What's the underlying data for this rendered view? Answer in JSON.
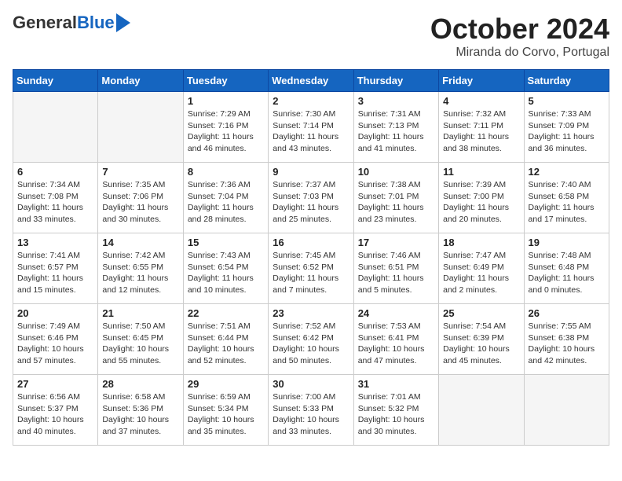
{
  "logo": {
    "general": "General",
    "blue": "Blue"
  },
  "title": "October 2024",
  "location": "Miranda do Corvo, Portugal",
  "days_of_week": [
    "Sunday",
    "Monday",
    "Tuesday",
    "Wednesday",
    "Thursday",
    "Friday",
    "Saturday"
  ],
  "weeks": [
    [
      {
        "day": "",
        "info": ""
      },
      {
        "day": "",
        "info": ""
      },
      {
        "day": "1",
        "info": "Sunrise: 7:29 AM\nSunset: 7:16 PM\nDaylight: 11 hours and 46 minutes."
      },
      {
        "day": "2",
        "info": "Sunrise: 7:30 AM\nSunset: 7:14 PM\nDaylight: 11 hours and 43 minutes."
      },
      {
        "day": "3",
        "info": "Sunrise: 7:31 AM\nSunset: 7:13 PM\nDaylight: 11 hours and 41 minutes."
      },
      {
        "day": "4",
        "info": "Sunrise: 7:32 AM\nSunset: 7:11 PM\nDaylight: 11 hours and 38 minutes."
      },
      {
        "day": "5",
        "info": "Sunrise: 7:33 AM\nSunset: 7:09 PM\nDaylight: 11 hours and 36 minutes."
      }
    ],
    [
      {
        "day": "6",
        "info": "Sunrise: 7:34 AM\nSunset: 7:08 PM\nDaylight: 11 hours and 33 minutes."
      },
      {
        "day": "7",
        "info": "Sunrise: 7:35 AM\nSunset: 7:06 PM\nDaylight: 11 hours and 30 minutes."
      },
      {
        "day": "8",
        "info": "Sunrise: 7:36 AM\nSunset: 7:04 PM\nDaylight: 11 hours and 28 minutes."
      },
      {
        "day": "9",
        "info": "Sunrise: 7:37 AM\nSunset: 7:03 PM\nDaylight: 11 hours and 25 minutes."
      },
      {
        "day": "10",
        "info": "Sunrise: 7:38 AM\nSunset: 7:01 PM\nDaylight: 11 hours and 23 minutes."
      },
      {
        "day": "11",
        "info": "Sunrise: 7:39 AM\nSunset: 7:00 PM\nDaylight: 11 hours and 20 minutes."
      },
      {
        "day": "12",
        "info": "Sunrise: 7:40 AM\nSunset: 6:58 PM\nDaylight: 11 hours and 17 minutes."
      }
    ],
    [
      {
        "day": "13",
        "info": "Sunrise: 7:41 AM\nSunset: 6:57 PM\nDaylight: 11 hours and 15 minutes."
      },
      {
        "day": "14",
        "info": "Sunrise: 7:42 AM\nSunset: 6:55 PM\nDaylight: 11 hours and 12 minutes."
      },
      {
        "day": "15",
        "info": "Sunrise: 7:43 AM\nSunset: 6:54 PM\nDaylight: 11 hours and 10 minutes."
      },
      {
        "day": "16",
        "info": "Sunrise: 7:45 AM\nSunset: 6:52 PM\nDaylight: 11 hours and 7 minutes."
      },
      {
        "day": "17",
        "info": "Sunrise: 7:46 AM\nSunset: 6:51 PM\nDaylight: 11 hours and 5 minutes."
      },
      {
        "day": "18",
        "info": "Sunrise: 7:47 AM\nSunset: 6:49 PM\nDaylight: 11 hours and 2 minutes."
      },
      {
        "day": "19",
        "info": "Sunrise: 7:48 AM\nSunset: 6:48 PM\nDaylight: 11 hours and 0 minutes."
      }
    ],
    [
      {
        "day": "20",
        "info": "Sunrise: 7:49 AM\nSunset: 6:46 PM\nDaylight: 10 hours and 57 minutes."
      },
      {
        "day": "21",
        "info": "Sunrise: 7:50 AM\nSunset: 6:45 PM\nDaylight: 10 hours and 55 minutes."
      },
      {
        "day": "22",
        "info": "Sunrise: 7:51 AM\nSunset: 6:44 PM\nDaylight: 10 hours and 52 minutes."
      },
      {
        "day": "23",
        "info": "Sunrise: 7:52 AM\nSunset: 6:42 PM\nDaylight: 10 hours and 50 minutes."
      },
      {
        "day": "24",
        "info": "Sunrise: 7:53 AM\nSunset: 6:41 PM\nDaylight: 10 hours and 47 minutes."
      },
      {
        "day": "25",
        "info": "Sunrise: 7:54 AM\nSunset: 6:39 PM\nDaylight: 10 hours and 45 minutes."
      },
      {
        "day": "26",
        "info": "Sunrise: 7:55 AM\nSunset: 6:38 PM\nDaylight: 10 hours and 42 minutes."
      }
    ],
    [
      {
        "day": "27",
        "info": "Sunrise: 6:56 AM\nSunset: 5:37 PM\nDaylight: 10 hours and 40 minutes."
      },
      {
        "day": "28",
        "info": "Sunrise: 6:58 AM\nSunset: 5:36 PM\nDaylight: 10 hours and 37 minutes."
      },
      {
        "day": "29",
        "info": "Sunrise: 6:59 AM\nSunset: 5:34 PM\nDaylight: 10 hours and 35 minutes."
      },
      {
        "day": "30",
        "info": "Sunrise: 7:00 AM\nSunset: 5:33 PM\nDaylight: 10 hours and 33 minutes."
      },
      {
        "day": "31",
        "info": "Sunrise: 7:01 AM\nSunset: 5:32 PM\nDaylight: 10 hours and 30 minutes."
      },
      {
        "day": "",
        "info": ""
      },
      {
        "day": "",
        "info": ""
      }
    ]
  ]
}
